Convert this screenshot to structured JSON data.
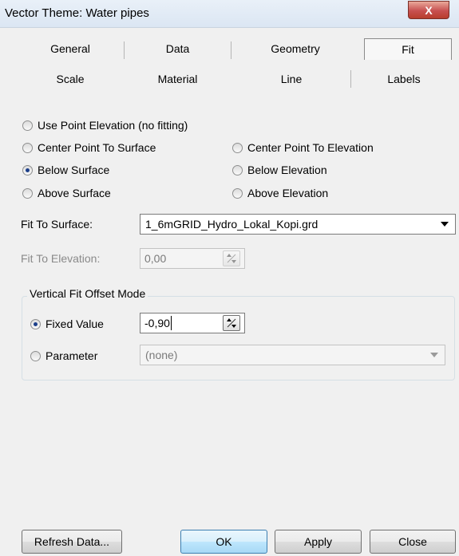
{
  "window": {
    "title": "Vector Theme: Water pipes",
    "close_label": "X"
  },
  "tabs_row1": [
    {
      "label": "General"
    },
    {
      "label": "Data"
    },
    {
      "label": "Geometry"
    },
    {
      "label": "Fit",
      "active": true
    }
  ],
  "tabs_row2": [
    {
      "label": "Scale"
    },
    {
      "label": "Material"
    },
    {
      "label": "Line"
    },
    {
      "label": "Labels"
    }
  ],
  "fit_options": {
    "use_point_elevation": {
      "label": "Use Point Elevation (no fitting)",
      "checked": false
    },
    "center_point_to_surface": {
      "label": "Center Point To Surface",
      "checked": false
    },
    "center_point_to_elevation": {
      "label": "Center Point To Elevation",
      "checked": false
    },
    "below_surface": {
      "label": "Below Surface",
      "checked": true
    },
    "below_elevation": {
      "label": "Below Elevation",
      "checked": false
    },
    "above_surface": {
      "label": "Above Surface",
      "checked": false
    },
    "above_elevation": {
      "label": "Above Elevation",
      "checked": false
    }
  },
  "fit_to_surface": {
    "label": "Fit To Surface:",
    "value": "1_6mGRID_Hydro_Lokal_Kopi.grd"
  },
  "fit_to_elevation": {
    "label": "Fit To Elevation:",
    "value": "0,00"
  },
  "vertical_offset": {
    "group_title": "Vertical Fit Offset Mode",
    "fixed_value": {
      "label": "Fixed Value",
      "checked": true,
      "value": "-0,90"
    },
    "parameter": {
      "label": "Parameter",
      "checked": false,
      "value": "(none)"
    }
  },
  "buttons": {
    "refresh": "Refresh Data...",
    "ok": "OK",
    "apply": "Apply",
    "close": "Close"
  },
  "colors": {
    "title_bar": "#dbe6f3",
    "close_button": "#c75050",
    "default_button": "#bee6fd",
    "dialog_bg": "#f0f0f0"
  }
}
